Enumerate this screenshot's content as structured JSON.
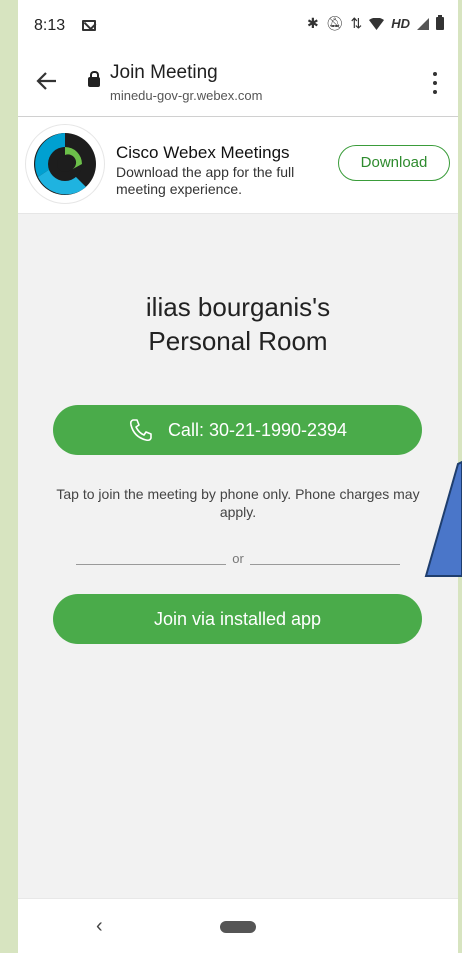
{
  "status_bar": {
    "time": "8:13",
    "network_label": "HD",
    "icons": [
      "mail-icon",
      "bluetooth-icon",
      "mute-icon",
      "data-arrows-icon",
      "wifi-icon",
      "signal-icon",
      "battery-icon"
    ]
  },
  "address_bar": {
    "title": "Join Meeting",
    "url": "minedu-gov-gr.webex.com"
  },
  "app_banner": {
    "title": "Cisco Webex Meetings",
    "description": "Download the app for the full meeting experience.",
    "download_label": "Download"
  },
  "meeting": {
    "title_line1": "ilias bourganis's",
    "title_line2": "Personal Room",
    "call_label": "Call: 30-21-1990-2394",
    "hint": "Tap to join the meeting by phone only. Phone charges may apply.",
    "or_label": "or",
    "join_app_label": "Join via installed app"
  },
  "nav_bar": {
    "back_glyph": "‹"
  },
  "colors": {
    "accent_green": "#4aab4a",
    "download_border": "#3a9c3a",
    "annotation_arrow": "#4a76c9",
    "outer_background": "#d7e4c0"
  }
}
